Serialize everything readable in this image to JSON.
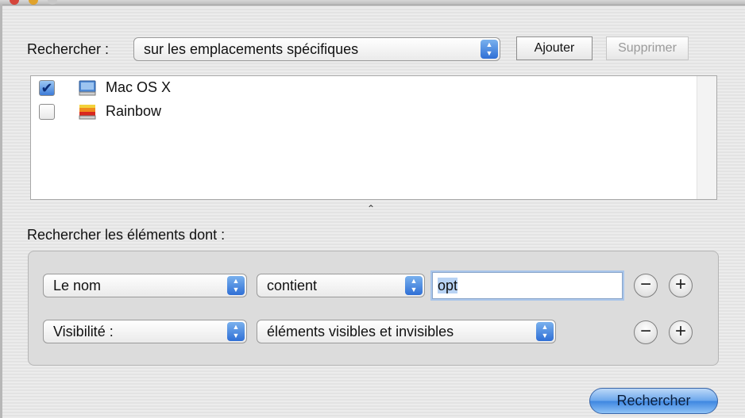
{
  "window": {
    "traffic_lights": [
      "#d5453b",
      "#e0a22b",
      "#c8c8c8"
    ]
  },
  "search_scope": {
    "label": "Rechercher :",
    "selected": "sur les emplacements spécifiques",
    "add_button": "Ajouter",
    "remove_button": "Supprimer",
    "remove_enabled": false
  },
  "locations": [
    {
      "label": "Mac OS X",
      "checked": true,
      "icon": "hard-drive-icon"
    },
    {
      "label": "Rainbow",
      "checked": false,
      "icon": "rainbow-drive-icon"
    }
  ],
  "splitter": {
    "glyph": "⌃"
  },
  "criteria": {
    "label": "Rechercher les éléments dont :",
    "rows": [
      {
        "attribute": "Le nom",
        "operator": "contient",
        "value": "opt"
      },
      {
        "attribute": "Visibilité :",
        "operator": "éléments visibles et invisibles"
      }
    ],
    "minus_glyph": "−",
    "plus_glyph": "+"
  },
  "search_button": "Rechercher"
}
